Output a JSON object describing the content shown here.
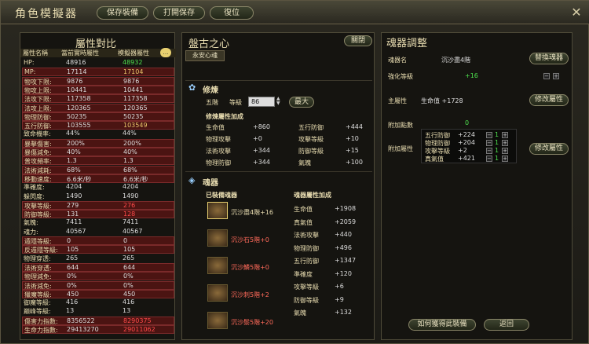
{
  "window": {
    "title": "角色模擬器",
    "save_label": "保存裝備",
    "open_label": "打開保存",
    "reset_label": "復位"
  },
  "left": {
    "title": "屬性對比",
    "headers": [
      "屬性名稱",
      "當前實時屬性",
      "模擬器屬性"
    ],
    "rows": [
      [
        "HP:",
        "48916",
        "48932"
      ],
      [
        "MP:",
        "17114",
        "17104"
      ],
      [
        "物攻下限:",
        "9876",
        "9876"
      ],
      [
        "物攻上限:",
        "10441",
        "10441"
      ],
      [
        "法攻下限:",
        "117358",
        "117358"
      ],
      [
        "法攻上限:",
        "120365",
        "120365"
      ],
      [
        "物理防御:",
        "50235",
        "50235"
      ],
      [
        "五行防御:",
        "103555",
        "103549"
      ],
      [
        "致命機率:",
        "44%",
        "44%"
      ],
      [
        "暴擊傷害:",
        "200%",
        "200%"
      ],
      [
        "暴傷減免:",
        "40%",
        "40%"
      ],
      [
        "普攻頻率:",
        "1.3",
        "1.3"
      ],
      [
        "法術減耗:",
        "68%",
        "68%"
      ],
      [
        "移動速度:",
        "6.6米/秒",
        "6.6米/秒"
      ],
      [
        "準確度:",
        "4204",
        "4204"
      ],
      [
        "躲閃度:",
        "1490",
        "1490"
      ],
      [
        "攻擊等級:",
        "279",
        "276"
      ],
      [
        "防御等級:",
        "131",
        "128"
      ],
      [
        "氣魄:",
        "7411",
        "7411"
      ],
      [
        "魂力:",
        "40567",
        "40567"
      ],
      [
        "遁隱等級:",
        "0",
        "0"
      ],
      [
        "反遁隱等級:",
        "105",
        "105"
      ],
      [
        "物理穿透:",
        "265",
        "265"
      ],
      [
        "法術穿透:",
        "644",
        "644"
      ],
      [
        "物理減免:",
        "0%",
        "0%"
      ],
      [
        "法術減免:",
        "0%",
        "0%"
      ],
      [
        "獵魔等級:",
        "450",
        "450"
      ],
      [
        "御魔等級:",
        "416",
        "416"
      ],
      [
        "巔峰等級:",
        "13",
        "13"
      ],
      [
        "傷害力指數:",
        "8356522",
        "8290375"
      ],
      [
        "生命力指數:",
        "29413270",
        "29011062"
      ]
    ]
  },
  "mid": {
    "title": "盤古之心",
    "close_label": "關閉",
    "tab": "永安心魂",
    "train": {
      "title": "修煉",
      "stage": "五階",
      "level_label": "等級",
      "level": "86",
      "max_label": "最大",
      "bonus_title": "修煉屬性加成",
      "stats": [
        [
          "生命值",
          "+860"
        ],
        [
          "五行防御",
          "+444"
        ],
        [
          "物理攻擊",
          "+0"
        ],
        [
          "攻擊等級",
          "+10"
        ],
        [
          "法術攻擊",
          "+344"
        ],
        [
          "防御等級",
          "+15"
        ],
        [
          "物理防御",
          "+344"
        ],
        [
          "氣魄",
          "+100"
        ]
      ]
    },
    "soul": {
      "title": "魂器",
      "equipped_title": "已裝備魂器",
      "bonus_title": "魂器屬性加成",
      "items": [
        "沉沙盡4階+16",
        "沉沙石5階+0",
        "沉沙鱗5階+0",
        "沉沙刺5階+2",
        "沉沙鬃5階+20"
      ],
      "stats": [
        [
          "生命值",
          "+1908"
        ],
        [
          "真氣值",
          "+2059"
        ],
        [
          "法術攻擊",
          "+440"
        ],
        [
          "物理防御",
          "+496"
        ],
        [
          "五行防御",
          "+1347"
        ],
        [
          "準確度",
          "+120"
        ],
        [
          "攻擊等級",
          "+6"
        ],
        [
          "防御等級",
          "+9"
        ],
        [
          "氣魄",
          "+132"
        ]
      ]
    }
  },
  "right": {
    "title": "魂器調整",
    "name_label": "魂器名",
    "name": "沉沙盡4階",
    "replace_label": "替換魂器",
    "enh_label": "強化等級",
    "enh": "+16",
    "main_label": "主屬性",
    "main": "生命值 +1728",
    "modify_label": "修改屬性",
    "extra_pts_label": "附加點數",
    "extra_pts": "0",
    "extra_label": "附加屬性",
    "extras": [
      [
        "五行防御",
        "+224",
        "1"
      ],
      [
        "物理防御",
        "+204",
        "1"
      ],
      [
        "攻擊等級",
        "+2",
        "1"
      ],
      [
        "真氣值",
        "+421",
        "1"
      ]
    ],
    "modify2_label": "修改屬性",
    "how_label": "如何獲得此裝備",
    "back_label": "返回"
  },
  "colors": {
    "green": "#4ee04e",
    "red": "#ff4a4a",
    "gold": "#e8c56a"
  }
}
